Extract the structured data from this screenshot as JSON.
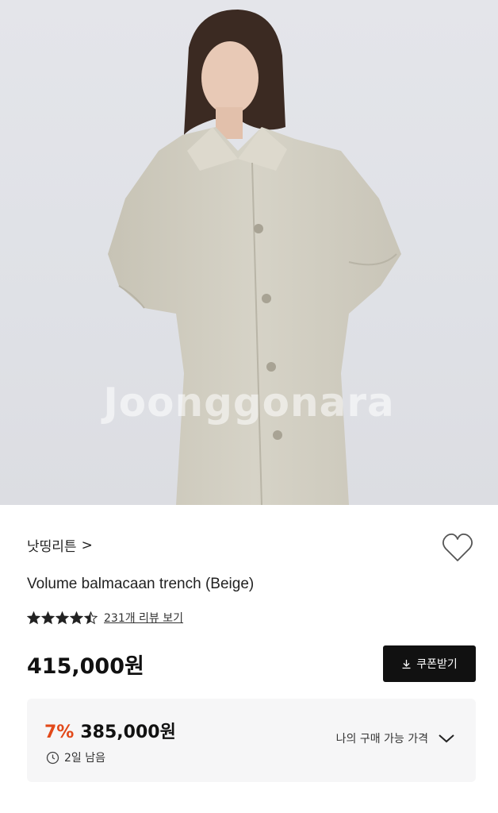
{
  "hero": {
    "watermark": "Joonggonara",
    "background_color": "#e0e2e7",
    "coat_color": "#d2cfc3"
  },
  "product": {
    "brand": "낫띵리튼",
    "brand_chevron": ">",
    "title": "Volume balmacaan trench (Beige)",
    "rating": 4.5,
    "review_link": "231개 리뷰 보기",
    "price": "415,000원",
    "wishlist_icon": "heart-outline-icon"
  },
  "coupon": {
    "label": "쿠폰받기",
    "icon": "download-icon"
  },
  "discount": {
    "percent": "7%",
    "price": "385,000원",
    "time_left": "2일 남음",
    "time_icon": "clock-icon",
    "my_price_label": "나의 구매 가능 가격",
    "expand_icon": "chevron-down-icon",
    "accent_color": "#e2491a"
  }
}
